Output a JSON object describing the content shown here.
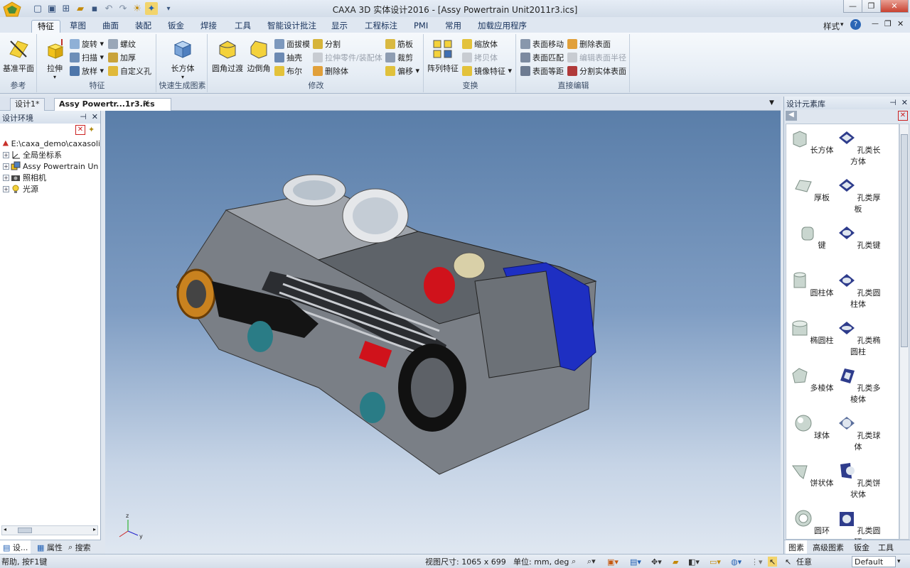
{
  "app": {
    "title": "CAXA 3D 实体设计2016 - [Assy Powertrain Unit2011r3.ics]",
    "style_menu": "样式",
    "help_icon": "question-icon"
  },
  "ribbon_tabs": [
    "特征",
    "草图",
    "曲面",
    "装配",
    "钣金",
    "焊接",
    "工具",
    "智能设计批注",
    "显示",
    "工程标注",
    "PMI",
    "常用",
    "加载应用程序"
  ],
  "ribbon": {
    "ref": {
      "label": "参考",
      "big": "基准平面"
    },
    "feature": {
      "label": "特征",
      "big": "拉伸",
      "items": [
        "旋转",
        "扫描",
        "放样",
        "螺纹",
        "加厚",
        "自定义孔"
      ]
    },
    "quick": {
      "label": "快速生成图素",
      "big": "长方体"
    },
    "modify": {
      "label": "修改",
      "big1": "圆角过渡",
      "big2": "边倒角",
      "col1": [
        "面拔模",
        "抽壳",
        "布尔"
      ],
      "col2": [
        "分割",
        "拉伸零件/装配体",
        "删除体"
      ],
      "col3": [
        "筋板",
        "裁剪",
        "偏移"
      ]
    },
    "transform": {
      "label": "变换",
      "big": "阵列特征",
      "items": [
        "缩放体",
        "拷贝体",
        "镜像特征"
      ]
    },
    "direct": {
      "label": "直接编辑",
      "col1": [
        "表面移动",
        "表面匹配",
        "表面等距"
      ],
      "col2": [
        "删除表面",
        "编辑表面半径",
        "分割实体表面"
      ]
    }
  },
  "doc_tabs": [
    "设计1*",
    "Assy Powertr...1r3.ics"
  ],
  "left_panel": {
    "title": "设计环境",
    "tree": [
      {
        "label": "E:\\caxa_demo\\caxasoli",
        "icon": "design-root-icon",
        "expand": ""
      },
      {
        "label": "全局坐标系",
        "icon": "axes-icon",
        "expand": "+"
      },
      {
        "label": "Assy Powertrain Un",
        "icon": "assembly-icon",
        "expand": "+"
      },
      {
        "label": "照相机",
        "icon": "camera-icon",
        "expand": "+"
      },
      {
        "label": "光源",
        "icon": "light-icon",
        "expand": "+"
      }
    ],
    "bottom_tabs": [
      "设...",
      "属性",
      "搜索"
    ]
  },
  "right_panel": {
    "title": "设计元素库",
    "items": [
      "长方体",
      "孔类长方体",
      "厚板",
      "孔类厚板",
      "键",
      "孔类键",
      "圆柱体",
      "孔类圆柱体",
      "椭圆柱",
      "孔类椭圆柱",
      "多棱体",
      "孔类多棱体",
      "球体",
      "孔类球体",
      "饼状体",
      "孔类饼状体",
      "圆环",
      "孔类圆环"
    ],
    "bottom_tabs": [
      "图素",
      "高级图素",
      "钣金",
      "工具"
    ]
  },
  "status": {
    "help": "帮助, 按F1键",
    "view_size": "视图尺寸: 1065 x 699",
    "units": "单位: mm, deg",
    "select": "任意",
    "config": "Default"
  },
  "colors": {
    "accent": "#1f5fb4",
    "ribbon": "#e6edf5",
    "viewport_top": "#5a7ea9",
    "viewport_bottom": "#dfe7f1"
  }
}
